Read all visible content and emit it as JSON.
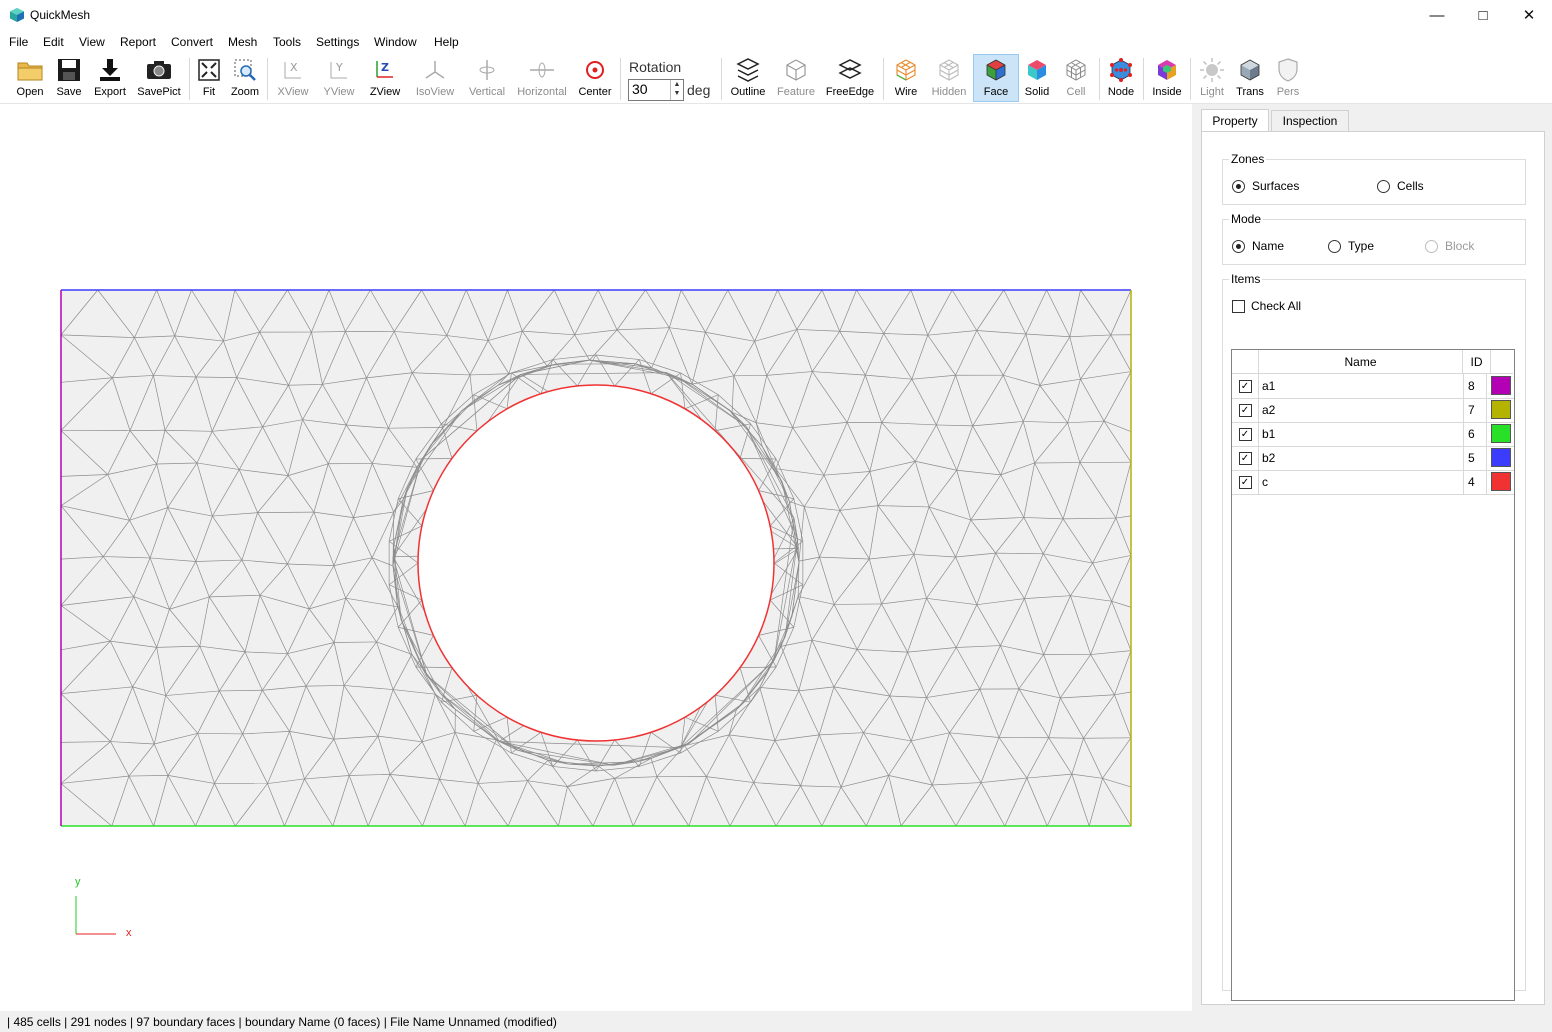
{
  "window": {
    "title": "QuickMesh"
  },
  "menu": [
    "File",
    "Edit",
    "View",
    "Report",
    "Convert",
    "Mesh",
    "Tools",
    "Settings",
    "Window",
    "Help"
  ],
  "toolbar": {
    "open": "Open",
    "save": "Save",
    "export": "Export",
    "savepict": "SavePict",
    "fit": "Fit",
    "zoom": "Zoom",
    "xview": "XView",
    "yview": "YView",
    "zview": "ZView",
    "isoview": "IsoView",
    "vertical": "Vertical",
    "horizontal": "Horizontal",
    "center": "Center",
    "rotation_label": "Rotation",
    "rotation_value": "30",
    "rotation_unit": "deg",
    "outline": "Outline",
    "feature": "Feature",
    "freeedge": "FreeEdge",
    "wire": "Wire",
    "hidden": "Hidden",
    "face": "Face",
    "solid": "Solid",
    "cell": "Cell",
    "node": "Node",
    "inside": "Inside",
    "light": "Light",
    "trans": "Trans",
    "pers": "Pers"
  },
  "viewport": {
    "axis_y": "y",
    "axis_x": "x",
    "colors": {
      "a1": "#b400b4",
      "a2": "#b4b400",
      "b1": "#28e028",
      "b2": "#3c3cff",
      "c": "#f03232",
      "mesh_fill": "#f0f0f0",
      "mesh_line": "#8c8c8c"
    }
  },
  "panel": {
    "tabs": [
      "Property",
      "Inspection"
    ],
    "zones": {
      "title": "Zones",
      "surfaces": "Surfaces",
      "cells": "Cells",
      "selected": "Surfaces"
    },
    "mode": {
      "title": "Mode",
      "name": "Name",
      "type": "Type",
      "block": "Block",
      "selected": "Name"
    },
    "items": {
      "title": "Items",
      "check_all": "Check All",
      "col_name": "Name",
      "col_id": "ID",
      "rows": [
        {
          "name": "a1",
          "id": "8",
          "color": "#b400b4",
          "checked": true
        },
        {
          "name": "a2",
          "id": "7",
          "color": "#b4b400",
          "checked": true
        },
        {
          "name": "b1",
          "id": "6",
          "color": "#28e028",
          "checked": true
        },
        {
          "name": "b2",
          "id": "5",
          "color": "#3c3cff",
          "checked": true
        },
        {
          "name": "c",
          "id": "4",
          "color": "#f03232",
          "checked": true
        }
      ]
    }
  },
  "status": "| 485 cells | 291 nodes | 97 boundary faces |  boundary Name  (0 faces) | File Name Unnamed (modified)"
}
